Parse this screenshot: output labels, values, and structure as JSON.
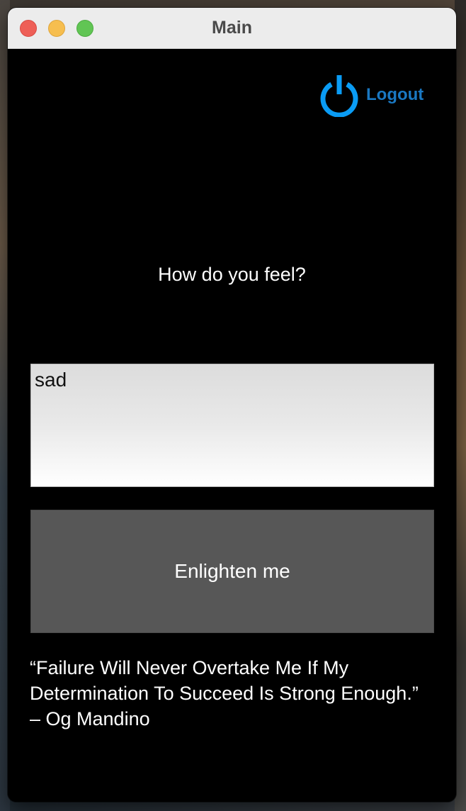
{
  "window": {
    "title": "Main"
  },
  "logout": {
    "label": "Logout",
    "icon": "power-icon",
    "color": "#1a78c2",
    "icon_color": "#0a9cf5"
  },
  "main": {
    "question": "How do you feel?",
    "feeling_input_value": "sad",
    "enlighten_label": "Enlighten me",
    "quote": "“Failure Will Never Overtake Me If My Determination To Succeed Is Strong Enough.” – Og Mandino"
  }
}
